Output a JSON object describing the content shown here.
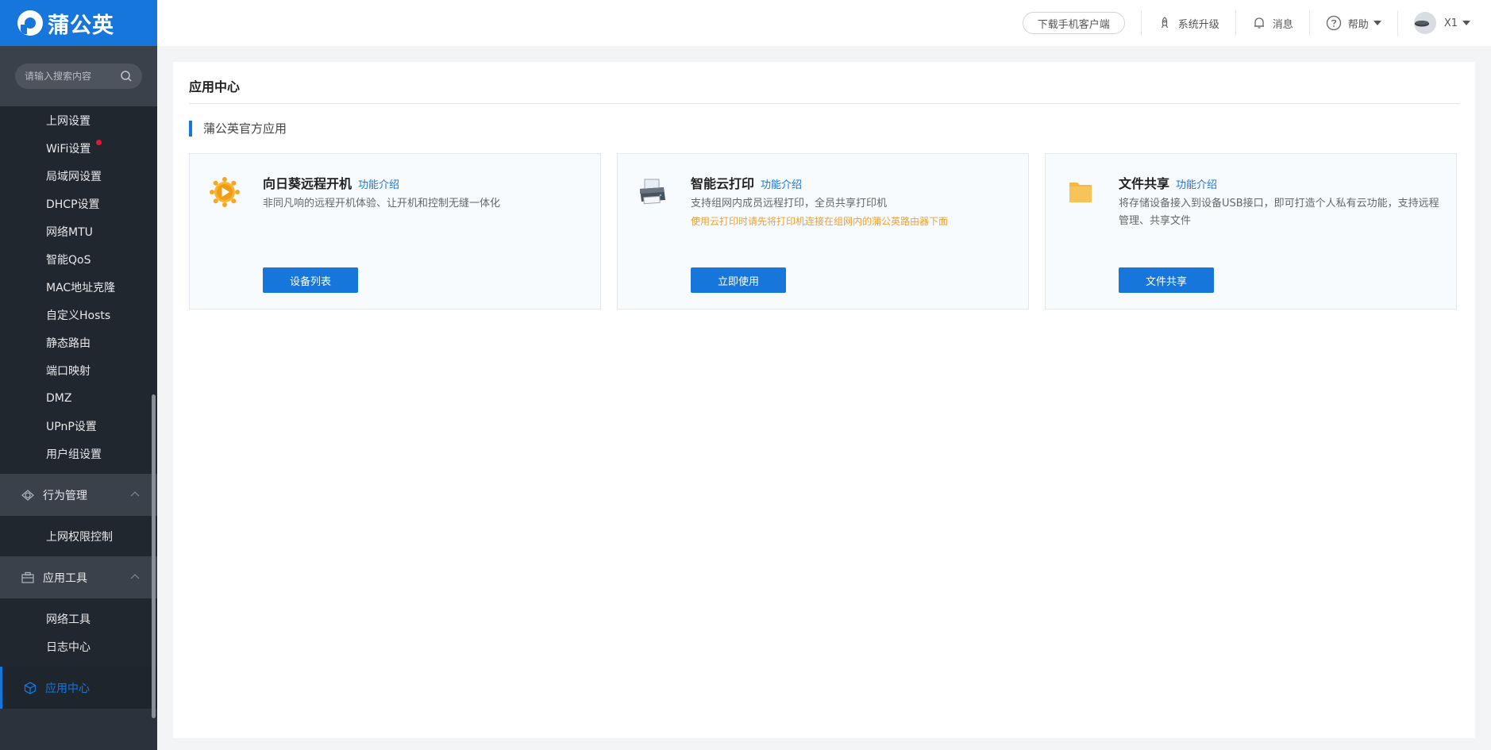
{
  "app": {
    "logo_text": "蒲公英"
  },
  "search": {
    "placeholder": "请输入搜索内容"
  },
  "sidebar": {
    "network_items": [
      {
        "label": "上网设置"
      },
      {
        "label": "WiFi设置"
      },
      {
        "label": "局域网设置"
      },
      {
        "label": "DHCP设置"
      },
      {
        "label": "网络MTU"
      },
      {
        "label": "智能QoS"
      },
      {
        "label": "MAC地址克隆"
      },
      {
        "label": "自定义Hosts"
      },
      {
        "label": "静态路由"
      },
      {
        "label": "端口映射"
      },
      {
        "label": "DMZ"
      },
      {
        "label": "UPnP设置"
      },
      {
        "label": "用户组设置"
      }
    ],
    "behavior_group": {
      "label": "行为管理",
      "items": [
        {
          "label": "上网权限控制"
        }
      ]
    },
    "tools_group": {
      "label": "应用工具",
      "items": [
        {
          "label": "网络工具"
        },
        {
          "label": "日志中心"
        }
      ]
    },
    "app_center": {
      "label": "应用中心"
    }
  },
  "topbar": {
    "download_label": "下载手机客户端",
    "upgrade_label": "系统升级",
    "message_label": "消息",
    "help_label": "帮助",
    "device_label": "X1"
  },
  "main": {
    "page_title": "应用中心",
    "section_title": "蒲公英官方应用",
    "cards": [
      {
        "title": "向日葵远程开机",
        "link": "功能介绍",
        "desc": "非同凡响的远程开机体验、让开机和控制无缝一体化",
        "warn": "",
        "button": "设备列表"
      },
      {
        "title": "智能云打印",
        "link": "功能介绍",
        "desc": "支持组网内成员远程打印，全员共享打印机",
        "warn": "使用云打印时请先将打印机连接在组网内的蒲公英路由器下面",
        "button": "立即使用"
      },
      {
        "title": "文件共享",
        "link": "功能介绍",
        "desc": "将存储设备接入到设备USB接口，即可打造个人私有云功能，支持远程管理、共享文件",
        "warn": "",
        "button": "文件共享"
      }
    ]
  },
  "colors": {
    "accent": "#1676dc",
    "sidebar_bg": "#2b323b",
    "warning": "#f0a030",
    "badge": "#e8153b"
  }
}
